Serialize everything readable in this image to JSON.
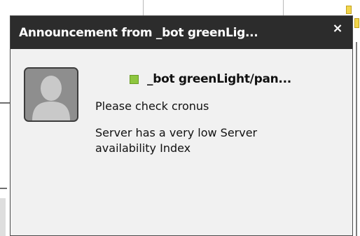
{
  "popup": {
    "title": "Announcement from _bot greenLig...",
    "close_label": "×",
    "sender": "_bot greenLight/pan...",
    "status_color": "#8ec63f",
    "message_lines": [
      "Please check cronus",
      "Server has a very low Server",
      "availability Index"
    ]
  },
  "icons": {
    "avatar": "default-user-avatar-icon",
    "status": "online-status-icon"
  }
}
